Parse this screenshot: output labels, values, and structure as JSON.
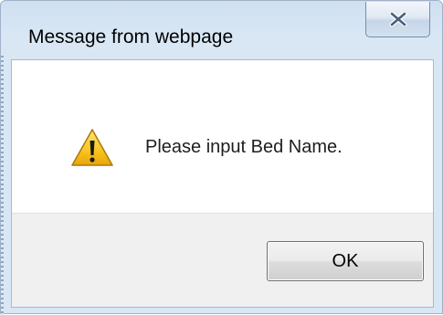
{
  "dialog": {
    "title": "Message from webpage",
    "message": "Please input Bed Name.",
    "icon": "warning-icon",
    "buttons": {
      "ok_label": "OK"
    },
    "close_icon": "close-icon"
  },
  "colors": {
    "frame": "#d9e7f5",
    "client_background": "#ffffff",
    "button_area_background": "#f0f0f0",
    "warning_yellow": "#f7c51e",
    "close_glyph": "#4a5f7d"
  }
}
